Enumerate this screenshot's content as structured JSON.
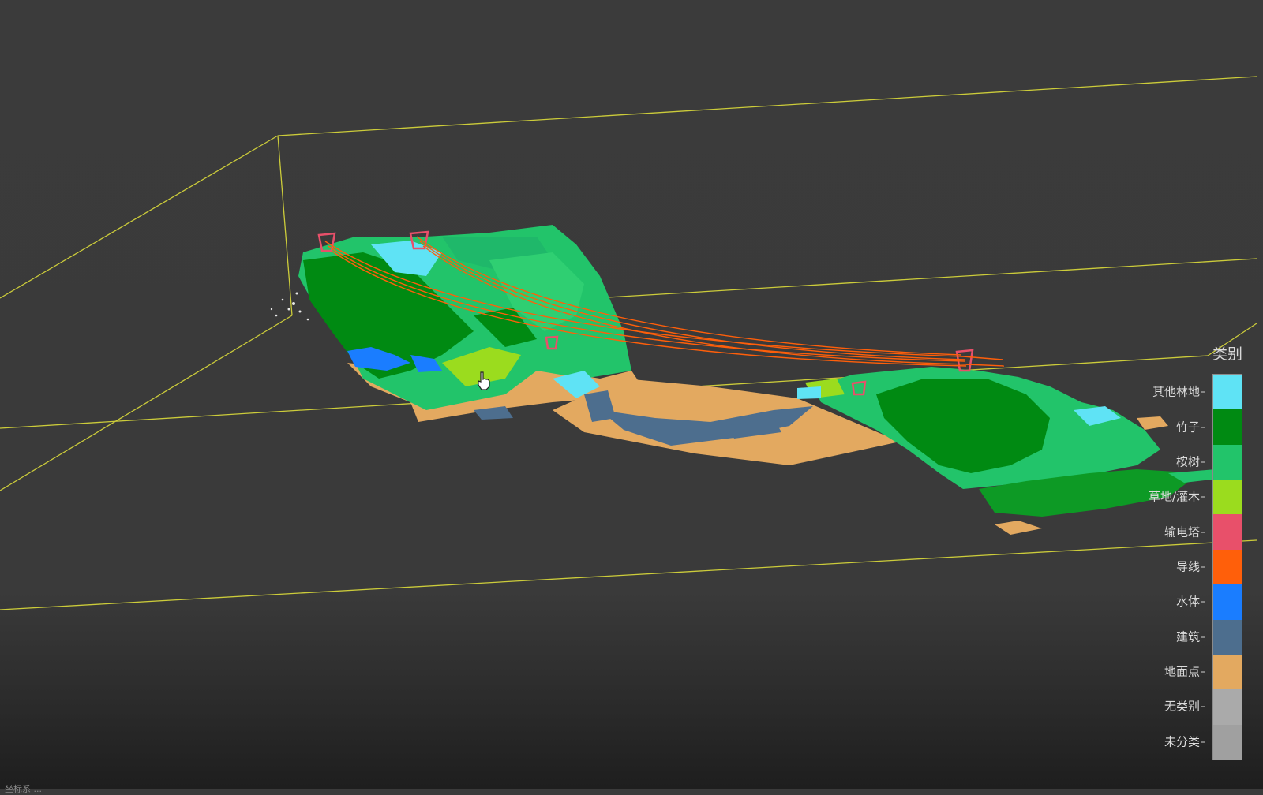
{
  "legend": {
    "title": "类别",
    "classes": [
      {
        "label": "其他林地",
        "color": "#5fe3f5"
      },
      {
        "label": "竹子",
        "color": "#008a12"
      },
      {
        "label": "桉树",
        "color": "#22c46a"
      },
      {
        "label": "草地/灌木",
        "color": "#9bdc1e"
      },
      {
        "label": "输电塔",
        "color": "#e8506a"
      },
      {
        "label": "导线",
        "color": "#ff5f0a"
      },
      {
        "label": "水体",
        "color": "#1a7dff"
      },
      {
        "label": "建筑",
        "color": "#4d6e8e"
      },
      {
        "label": "地面点",
        "color": "#e3a960"
      },
      {
        "label": "无类别",
        "color": "#aaaaaa"
      },
      {
        "label": "未分类",
        "color": "#a0a0a0"
      }
    ]
  },
  "scene": {
    "bbox_color": "#cccc3a",
    "background_color": "#3a3a3a"
  },
  "status": {
    "text": "坐标系 ..."
  }
}
